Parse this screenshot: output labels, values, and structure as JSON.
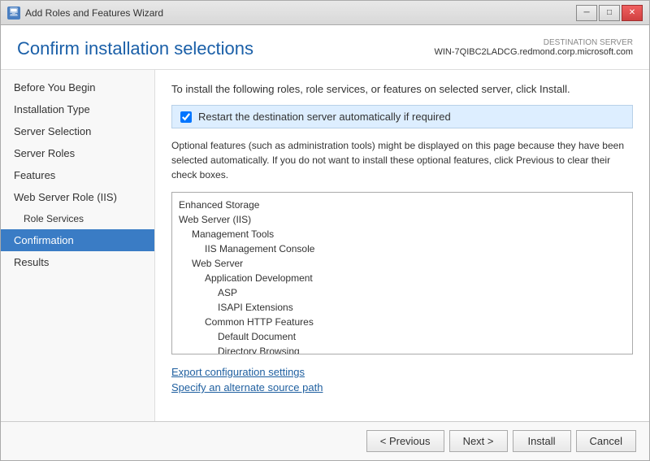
{
  "window": {
    "title": "Add Roles and Features Wizard",
    "icon": "🖥"
  },
  "titlebar": {
    "minimize": "─",
    "restore": "□",
    "close": "✕"
  },
  "header": {
    "title": "Confirm installation selections",
    "destination_label": "DESTINATION SERVER",
    "destination_name": "WIN-7QIBC2LADCG.redmond.corp.microsoft.com"
  },
  "content": {
    "description": "To install the following roles, role services, or features on selected server, click Install.",
    "checkbox_label": "Restart the destination server automatically if required",
    "optional_note": "Optional features (such as administration tools) might be displayed on this page because they have been selected automatically. If you do not want to install these optional features, click Previous to clear their check boxes.",
    "features": [
      {
        "label": "Enhanced Storage",
        "indent": 0
      },
      {
        "label": "Web Server (IIS)",
        "indent": 0
      },
      {
        "label": "Management Tools",
        "indent": 1
      },
      {
        "label": "IIS Management Console",
        "indent": 2
      },
      {
        "label": "Web Server",
        "indent": 1
      },
      {
        "label": "Application Development",
        "indent": 2
      },
      {
        "label": "ASP",
        "indent": 3
      },
      {
        "label": "ISAPI Extensions",
        "indent": 3
      },
      {
        "label": "Common HTTP Features",
        "indent": 2
      },
      {
        "label": "Default Document",
        "indent": 3
      },
      {
        "label": "Directory Browsing",
        "indent": 3
      }
    ],
    "link1": "Export configuration settings",
    "link2": "Specify an alternate source path"
  },
  "sidebar": {
    "items": [
      {
        "label": "Before You Begin",
        "active": false,
        "sub": false
      },
      {
        "label": "Installation Type",
        "active": false,
        "sub": false
      },
      {
        "label": "Server Selection",
        "active": false,
        "sub": false
      },
      {
        "label": "Server Roles",
        "active": false,
        "sub": false
      },
      {
        "label": "Features",
        "active": false,
        "sub": false
      },
      {
        "label": "Web Server Role (IIS)",
        "active": false,
        "sub": false
      },
      {
        "label": "Role Services",
        "active": false,
        "sub": true
      },
      {
        "label": "Confirmation",
        "active": true,
        "sub": false
      },
      {
        "label": "Results",
        "active": false,
        "sub": false
      }
    ]
  },
  "footer": {
    "previous": "< Previous",
    "next": "Next >",
    "install": "Install",
    "cancel": "Cancel"
  }
}
